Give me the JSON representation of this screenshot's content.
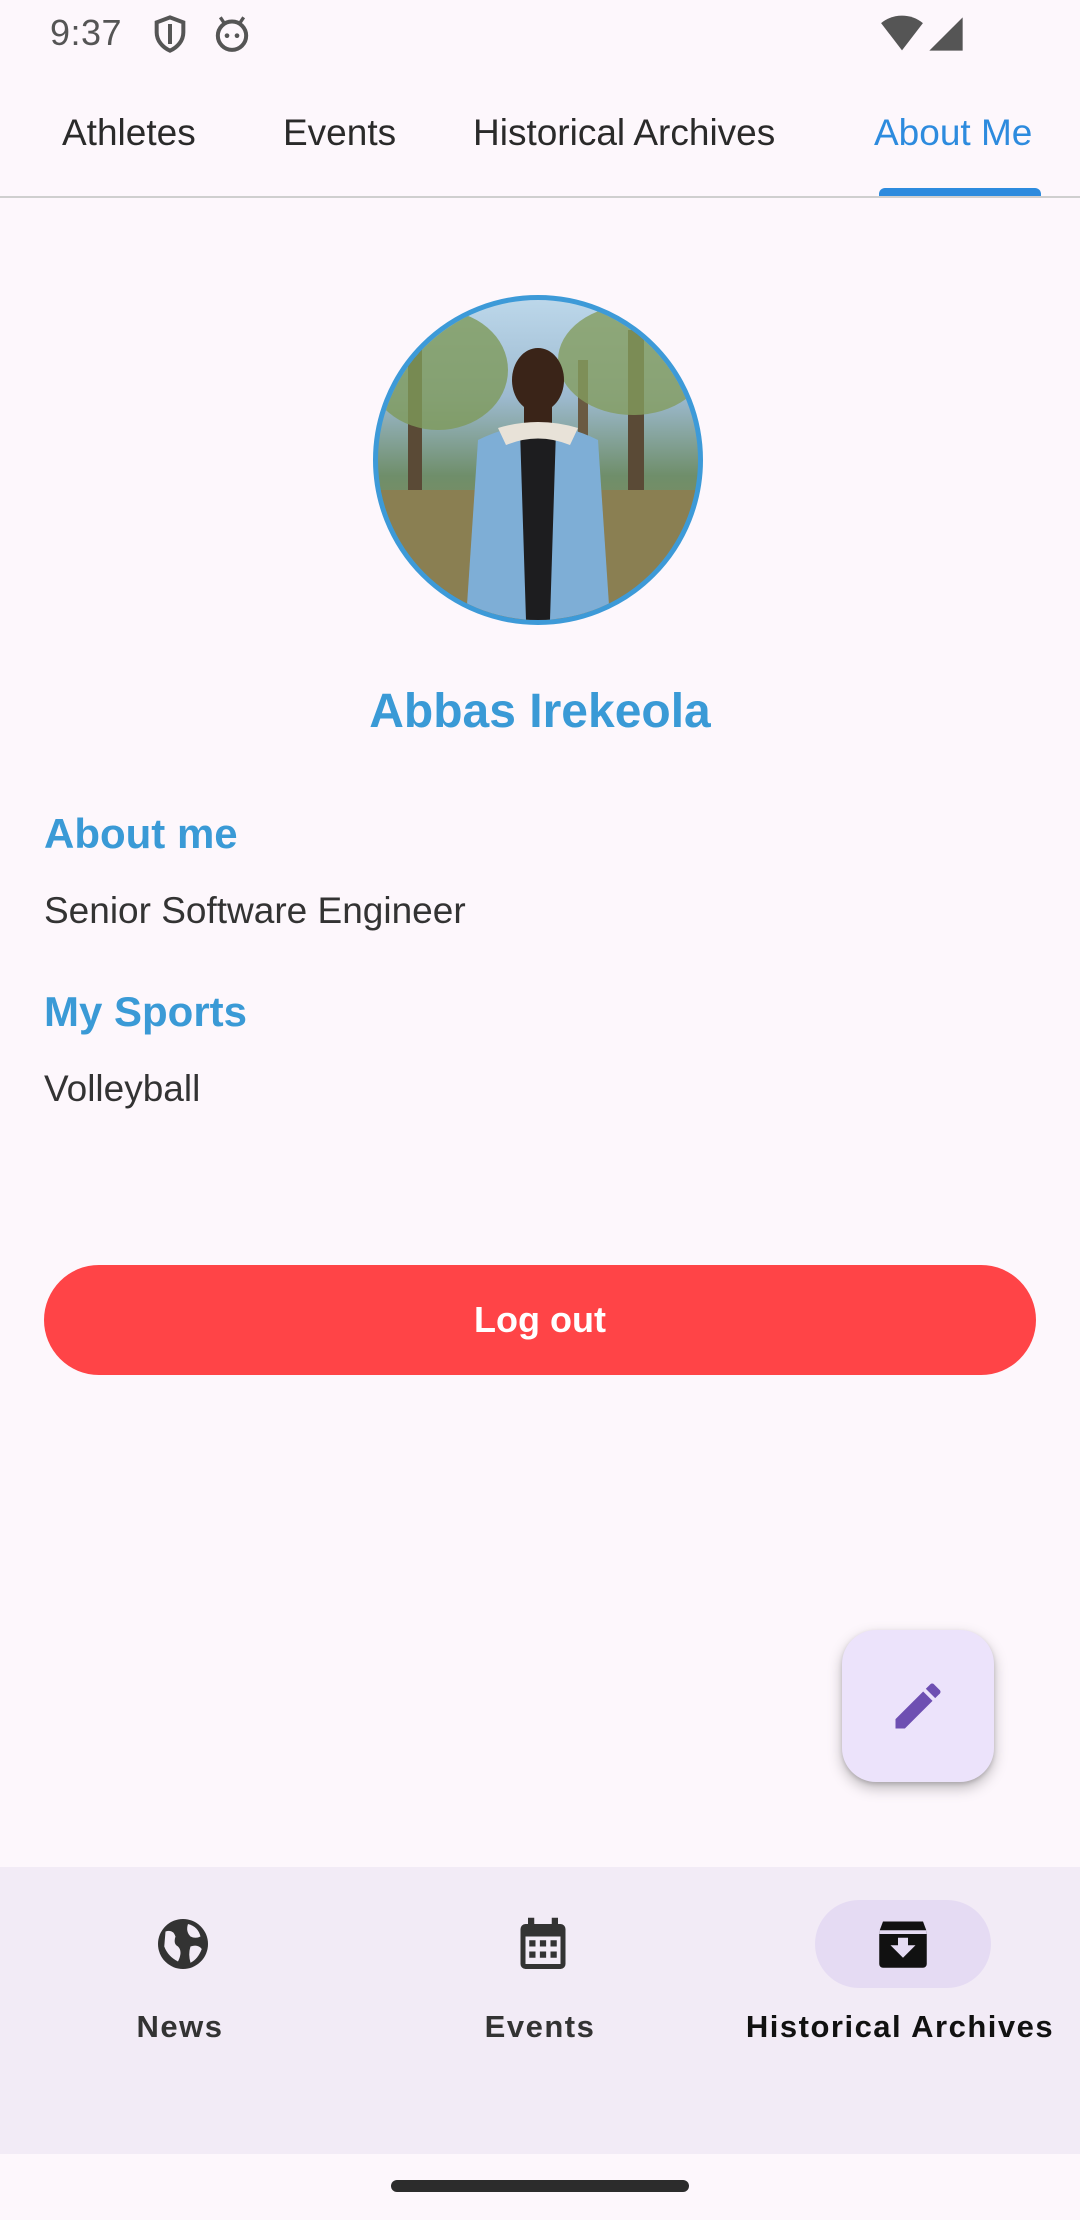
{
  "status_bar": {
    "time": "9:37",
    "icons": [
      "shield-icon",
      "android-icon",
      "wifi-icon",
      "signal-icon"
    ]
  },
  "top_tabs": [
    {
      "label": "Athletes",
      "active": false
    },
    {
      "label": "Events",
      "active": false
    },
    {
      "label": "Historical Archives",
      "active": false
    },
    {
      "label": "About Me",
      "active": true
    }
  ],
  "profile": {
    "avatar": "profile-photo",
    "name": "Abbas Irekeola",
    "about_title": "About me",
    "about_text": "Senior Software Engineer",
    "sports_title": "My Sports",
    "sports_text": "Volleyball"
  },
  "actions": {
    "logout_label": "Log out",
    "fab_icon": "pencil-icon"
  },
  "bottom_nav": [
    {
      "label": "News",
      "icon": "globe-icon",
      "active": false
    },
    {
      "label": "Events",
      "icon": "calendar-icon",
      "active": false
    },
    {
      "label": "Historical Archives",
      "icon": "archive-icon",
      "active": true
    }
  ],
  "colors": {
    "accent": "#2d8bde",
    "title_blue": "#3a9ad6",
    "logout_red": "#ff4447",
    "fab_bg": "#ece3fb",
    "fab_icon": "#6e4fb2",
    "background": "#fdf7fc",
    "nav_bg": "#f2ebf6",
    "nav_pill": "#e5dbf3"
  }
}
